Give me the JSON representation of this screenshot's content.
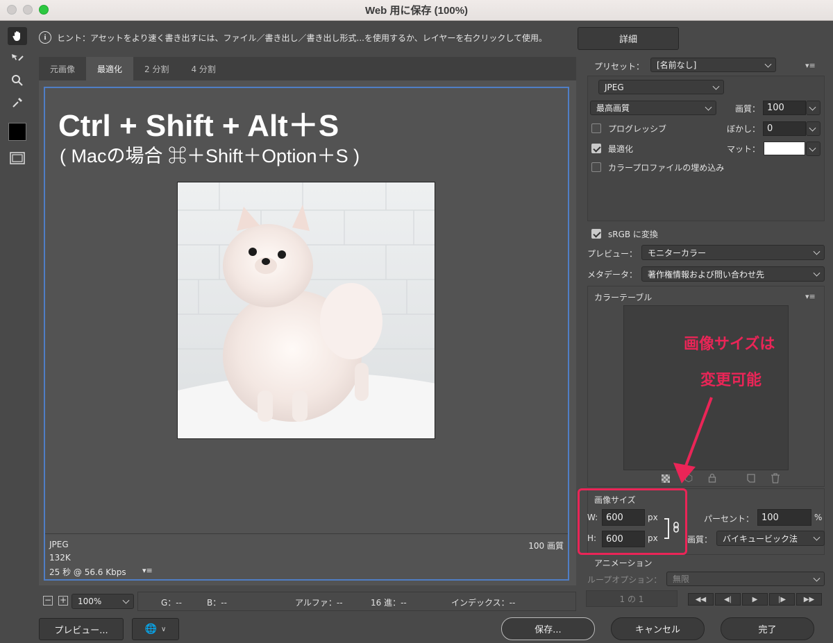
{
  "window": {
    "title": "Web 用に保存 (100%)"
  },
  "hint": {
    "text": "ヒント：アセットをより速く書き出すには、ファイル／書き出し／書き出し形式...を使用するか、レイヤーを右クリックして使用。",
    "detail_button": "詳細"
  },
  "tabs": [
    {
      "label": "元画像"
    },
    {
      "label": "最適化"
    },
    {
      "label": "2 分割"
    },
    {
      "label": "4 分割"
    }
  ],
  "canvas": {
    "headline": "Ctrl + Shift + Alt＋S",
    "subline": "( Macの場合 ⌘＋Shift＋Option＋S )",
    "format": "JPEG",
    "size": "132K",
    "speed": "25 秒 @ 56.6 Kbps",
    "quality_label": "100 画質"
  },
  "settings": {
    "preset_label": "プリセット：",
    "preset_value": "[名前なし]",
    "format_value": "JPEG",
    "quality_preset": "最高画質",
    "quality_label": "画質：",
    "quality_value": "100",
    "progressive_label": "プログレッシブ",
    "blur_label": "ぼかし：",
    "blur_value": "0",
    "optimized_label": "最適化",
    "matte_label": "マット：",
    "embed_profile_label": "カラープロファイルの埋め込み",
    "srgb_label": "sRGB に変換",
    "preview_label": "プレビュー：",
    "preview_value": "モニターカラー",
    "metadata_label": "メタデータ：",
    "metadata_value": "著作権情報および問い合わせ先"
  },
  "color_table": {
    "title": "カラーテーブル"
  },
  "annotation": {
    "line1": "画像サイズは",
    "line2": "変更可能",
    "color": "#ea2557"
  },
  "image_size": {
    "title": "画像サイズ",
    "w_label": "W:",
    "w_value": "600",
    "w_unit": "px",
    "h_label": "H:",
    "h_value": "600",
    "h_unit": "px",
    "percent_label": "パーセント：",
    "percent_value": "100",
    "percent_unit": "%",
    "quality_label": "画質：",
    "quality_value": "バイキュービック法"
  },
  "animation": {
    "title": "アニメーション",
    "loop_label": "ループオプション：",
    "loop_value": "無限",
    "frame_counter": "1 の 1"
  },
  "status": {
    "zoom": "100%",
    "g": "G：--",
    "b": "B：--",
    "alpha": "アルファ：--",
    "hex": "16 進：--",
    "index": "インデックス：--"
  },
  "buttons": {
    "preview": "プレビュー...",
    "save": "保存...",
    "cancel": "キャンセル",
    "done": "完了"
  }
}
